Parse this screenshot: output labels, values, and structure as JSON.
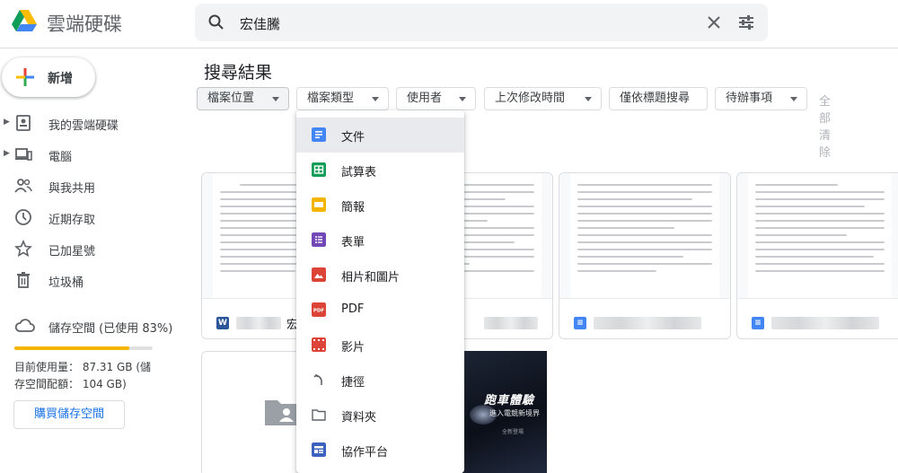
{
  "app": {
    "title": "雲端硬碟"
  },
  "search": {
    "query": "宏佳騰"
  },
  "new_button": {
    "label": "新增"
  },
  "sidebar": {
    "items": [
      {
        "label": "我的雲端硬碟",
        "icon": "my-drive-icon",
        "expandable": true
      },
      {
        "label": "電腦",
        "icon": "computer-icon",
        "expandable": true
      },
      {
        "label": "與我共用",
        "icon": "shared-icon",
        "expandable": false
      },
      {
        "label": "近期存取",
        "icon": "clock-icon",
        "expandable": false
      },
      {
        "label": "已加星號",
        "icon": "star-icon",
        "expandable": false
      },
      {
        "label": "垃圾桶",
        "icon": "trash-icon",
        "expandable": false
      }
    ],
    "storage": {
      "label": "儲存空間 (已使用 83%)",
      "used_percent": 83,
      "used_text": "目前使用量： 87.31 GB (儲",
      "quota_text": "存空間配額： 104 GB)",
      "buy_label": "購買儲存空間",
      "bar_color": "#f4b400"
    }
  },
  "main": {
    "title": "搜尋結果",
    "filters": [
      "檔案位置",
      "檔案類型",
      "使用者",
      "上次修改時間",
      "僅依標題搜尋",
      "待辦事項"
    ],
    "clear_all": "全部清除",
    "cards": [
      {
        "type": "word",
        "type_letter": "W",
        "name_suffix": "宏"
      },
      {
        "type": "docs",
        "type_letter": "",
        "name_suffix": ""
      },
      {
        "type": "docs",
        "type_letter": "",
        "name_suffix": ""
      },
      {
        "type": "docs",
        "type_letter": "",
        "name_suffix": ""
      }
    ]
  },
  "poster": {
    "line1": "跑車體驗",
    "line2": "進入電競新境界",
    "line3": "全新登場"
  },
  "file_type_menu": {
    "items": [
      {
        "label": "文件",
        "icon": "docs-icon",
        "color": "#4285f4"
      },
      {
        "label": "試算表",
        "icon": "sheets-icon",
        "color": "#0f9d58"
      },
      {
        "label": "簡報",
        "icon": "slides-icon",
        "color": "#f4b400"
      },
      {
        "label": "表單",
        "icon": "forms-icon",
        "color": "#7248b9"
      },
      {
        "label": "相片和圖片",
        "icon": "image-icon",
        "color": "#db4437"
      },
      {
        "label": "PDF",
        "icon": "pdf-icon",
        "color": "#db4437"
      },
      {
        "label": "影片",
        "icon": "video-icon",
        "color": "#db4437"
      },
      {
        "label": "捷徑",
        "icon": "shortcut-icon",
        "color": "#5f6368"
      },
      {
        "label": "資料夾",
        "icon": "folder-icon",
        "color": "#5f6368"
      },
      {
        "label": "協作平台",
        "icon": "sites-icon",
        "color": "#3c62be"
      }
    ]
  }
}
